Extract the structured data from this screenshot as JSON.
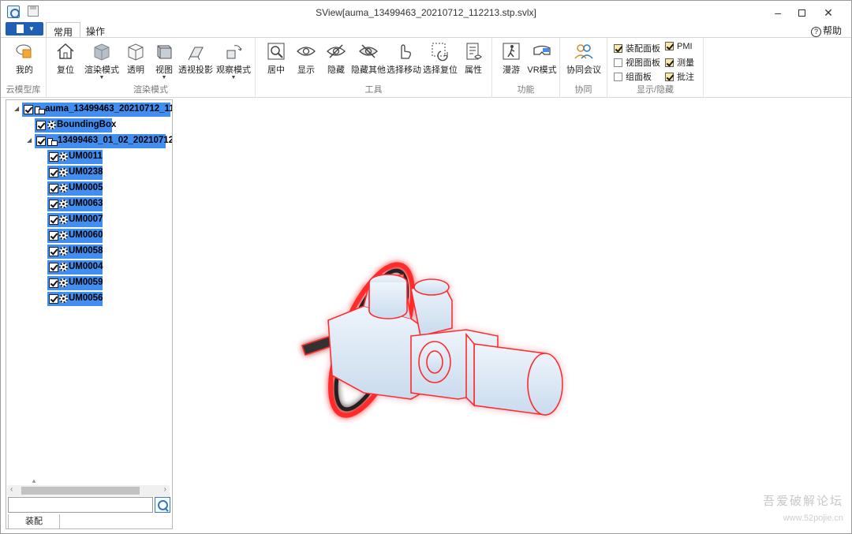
{
  "window": {
    "title": "SView[auma_13499463_20210712_112213.stp.svlx]"
  },
  "tabs": [
    {
      "label": "常用"
    },
    {
      "label": "操作"
    }
  ],
  "help": {
    "label": "帮助"
  },
  "ribbon": {
    "groups": {
      "cloud": {
        "label": "云模型库",
        "buttons": [
          {
            "label": "我的"
          }
        ]
      },
      "render": {
        "label": "渲染模式",
        "buttons": [
          {
            "label": "复位"
          },
          {
            "label": "渲染模式"
          },
          {
            "label": "透明"
          },
          {
            "label": "视图"
          },
          {
            "label": "透视投影"
          },
          {
            "label": "观察模式"
          }
        ]
      },
      "tools": {
        "label": "工具",
        "buttons": [
          {
            "label": "居中"
          },
          {
            "label": "显示"
          },
          {
            "label": "隐藏"
          },
          {
            "label": "隐藏其他"
          },
          {
            "label": "选择移动"
          },
          {
            "label": "选择复位"
          },
          {
            "label": "属性"
          }
        ]
      },
      "func": {
        "label": "功能",
        "buttons": [
          {
            "label": "漫游"
          },
          {
            "label": "VR模式"
          }
        ]
      },
      "collab": {
        "label": "协同",
        "buttons": [
          {
            "label": "协同会议"
          }
        ]
      },
      "display": {
        "label": "显示/隐藏",
        "checks": [
          {
            "label": "装配面板",
            "checked": true
          },
          {
            "label": "视图面板",
            "checked": false
          },
          {
            "label": "组面板",
            "checked": false
          },
          {
            "label": "PMI",
            "checked": true
          },
          {
            "label": "测量",
            "checked": true
          },
          {
            "label": "批注",
            "checked": true
          }
        ]
      }
    }
  },
  "tree": {
    "root": "auma_13499463_20210712_112",
    "bbox_node": "BoundingBox",
    "sub_assembly": "13499463_01_02_20210712",
    "parts": [
      "UM0011",
      "UM0238",
      "UM0005",
      "UM0063",
      "UM0007",
      "UM0060",
      "UM0058",
      "UM0004",
      "UM0059",
      "UM0056"
    ]
  },
  "panel": {
    "bottom_tab": "装配"
  },
  "watermark": {
    "text": "吾爱破解论坛",
    "url": "www.52pojie.cn"
  }
}
